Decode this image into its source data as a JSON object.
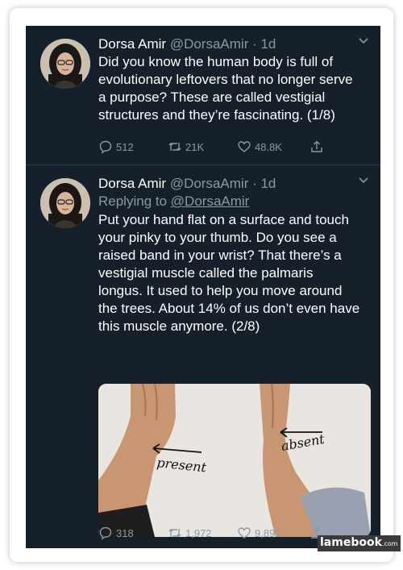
{
  "tweets": [
    {
      "name": "Dorsa Amir",
      "handle": "@DorsaAmir",
      "time": "· 1d",
      "text_lines": [
        "Did you know the human body is full of",
        "evolutionary leftovers that no longer serve",
        "a purpose? These are called vestigial",
        "structures and they’re fascinating. (1/8)"
      ],
      "replies": "512",
      "retweets": "21K",
      "likes": "48.8K"
    },
    {
      "name": "Dorsa Amir",
      "handle": "@DorsaAmir",
      "time": "· 1d",
      "replying_prefix": "Replying to",
      "replying_to": "@DorsaAmir",
      "text_lines": [
        "Put your hand flat on a surface and touch",
        "your pinky to your thumb. Do you see a",
        "raised band in your wrist? That there’s a",
        "vestigial muscle called the palmaris",
        "longus. It used to help you move around",
        "the trees. About 14% of us don’t even have",
        "this muscle anymore. (2/8)"
      ],
      "image_labels": {
        "left": "present",
        "right": "absent"
      },
      "replies": "318",
      "retweets": "1,972",
      "likes": "9,891"
    }
  ],
  "watermark": {
    "main": "lamebook",
    "suffix": ".com"
  },
  "colors": {
    "background": "#15202b",
    "text": "#ffffff",
    "secondary": "#8899a6"
  },
  "icons": [
    "chevron-down-icon",
    "reply-icon",
    "retweet-icon",
    "like-icon",
    "share-icon"
  ]
}
